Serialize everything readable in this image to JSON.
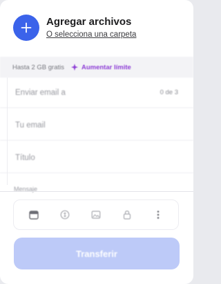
{
  "upload": {
    "title": "Agregar archivos",
    "folder_link": "O selecciona una carpeta",
    "add_icon": "plus-icon",
    "accent_color": "#3b63ea"
  },
  "quota": {
    "text": "Hasta 2 GB gratis",
    "upgrade_label": "Aumentar límite",
    "upgrade_icon": "sparkle-icon",
    "upgrade_color": "#8e3fd6"
  },
  "form": {
    "email_to_placeholder": "Enviar email a",
    "email_to_counter": "0 de 3",
    "your_email_placeholder": "Tu email",
    "title_placeholder": "Título",
    "message_label": "Mensaje"
  },
  "toolbar": {
    "items": [
      {
        "name": "calendar-icon"
      },
      {
        "name": "currency-icon"
      },
      {
        "name": "image-icon"
      },
      {
        "name": "lock-icon"
      },
      {
        "name": "more-icon"
      }
    ]
  },
  "transfer": {
    "label": "Transferir",
    "color": "#bdcaf8"
  }
}
